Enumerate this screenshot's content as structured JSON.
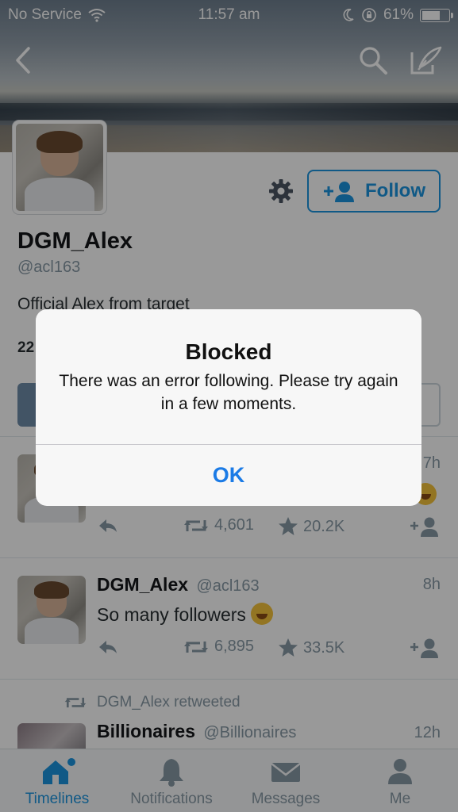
{
  "status_bar": {
    "carrier": "No Service",
    "time": "11:57 am",
    "battery": "61%"
  },
  "profile": {
    "display_name": "DGM_Alex",
    "handle": "@acl163",
    "bio": "Official Alex from target",
    "stat_fragment": "22",
    "follow_label": "Follow"
  },
  "tweets": [
    {
      "time": "7h",
      "retweets": "4,601",
      "favorites": "20.2K"
    },
    {
      "name": "DGM_Alex",
      "handle": "@acl163",
      "time": "8h",
      "text": "So many followers",
      "retweets": "6,895",
      "favorites": "33.5K"
    },
    {
      "retweet_notice": "DGM_Alex retweeted",
      "name": "Billionaires",
      "handle": "@Billionaires",
      "time": "12h"
    }
  ],
  "tabs": [
    {
      "label": "Timelines"
    },
    {
      "label": "Notifications"
    },
    {
      "label": "Messages"
    },
    {
      "label": "Me"
    }
  ],
  "alert": {
    "title": "Blocked",
    "message": "There was an error following. Please try again in a few moments.",
    "ok_label": "OK"
  },
  "colors": {
    "accent": "#1b95e0",
    "ios_blue": "#1b7be6",
    "muted": "#8899a6"
  },
  "icons": [
    "wifi-icon",
    "moon-icon",
    "rotation-lock-icon",
    "battery-icon",
    "back-chevron-icon",
    "search-icon",
    "compose-icon",
    "gear-icon",
    "add-user-icon",
    "reply-icon",
    "retweet-icon",
    "star-icon",
    "home-icon",
    "bell-icon",
    "envelope-icon",
    "person-icon"
  ]
}
